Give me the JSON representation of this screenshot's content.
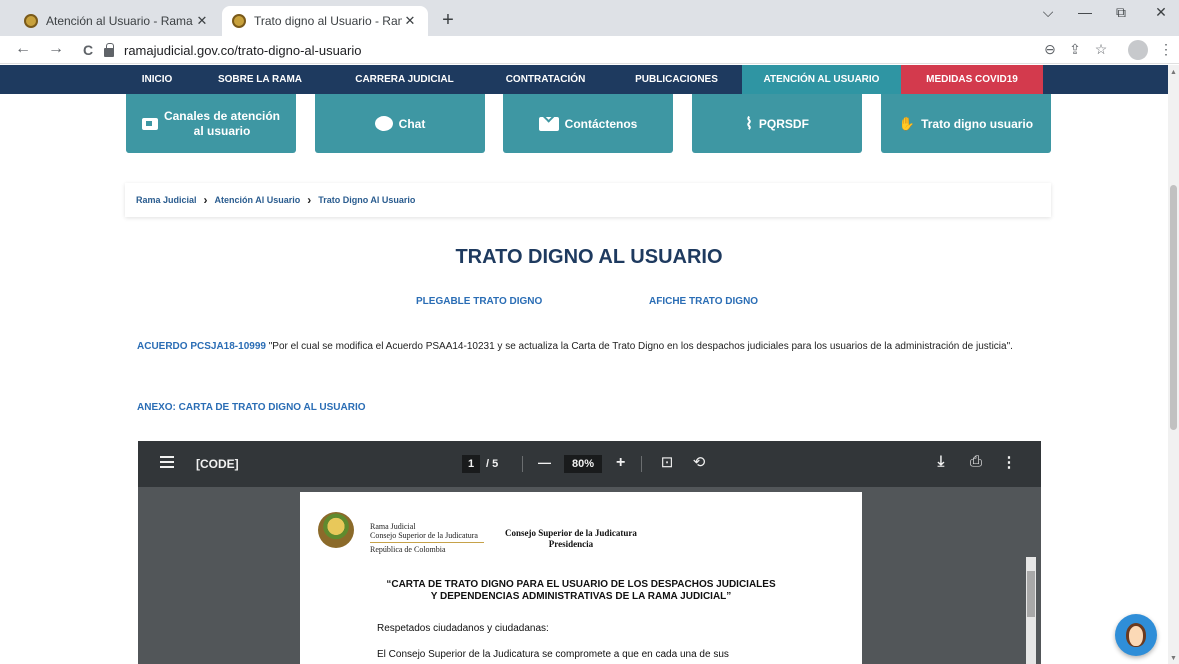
{
  "browser": {
    "tabs": [
      {
        "title": "Atención al Usuario - Rama Judicial",
        "close": "✕"
      },
      {
        "title": "Trato digno al Usuario - Rama Judicial",
        "close": "✕"
      }
    ],
    "new_tab": "+",
    "window_controls": [
      "⌵",
      "—",
      "⧉",
      "✕"
    ],
    "nav": {
      "back": "←",
      "forward": "→",
      "reload": "C"
    },
    "url": "ramajudicial.gov.co/trato-digno-al-usuario",
    "toolbar_icons": [
      "⊖",
      "⇪",
      "☆",
      "⋮"
    ]
  },
  "site_nav": {
    "items": [
      "INICIO",
      "SOBRE LA RAMA",
      "CARRERA JUDICIAL",
      "CONTRATACIÓN",
      "PUBLICACIONES",
      "ATENCIÓN AL USUARIO",
      "MEDIDAS COVID19"
    ],
    "active": "ATENCIÓN AL USUARIO"
  },
  "channels": [
    {
      "label_line1": "Canales de atención",
      "label_line2": "al usuario",
      "icon": "inbox-icon"
    },
    {
      "label": "Chat",
      "icon": "chat-bubble-icon"
    },
    {
      "label": "Contáctenos",
      "icon": "envelope-icon"
    },
    {
      "label": "PQRSDF",
      "icon": "paperclip-icon"
    },
    {
      "label": "Trato digno usuario",
      "icon": "handshake-icon"
    }
  ],
  "breadcrumb": [
    "Rama Judicial",
    "Atención Al Usuario",
    "Trato Digno Al Usuario"
  ],
  "breadcrumb_separator": "›",
  "page_title": "TRATO DIGNO AL USUARIO",
  "links": {
    "plegable": "PLEGABLE TRATO DIGNO",
    "afiche": "AFICHE TRATO DIGNO",
    "anexo": "ANEXO: CARTA DE TRATO DIGNO AL USUARIO"
  },
  "acuerdo": {
    "code": "ACUERDO PCSJA18-10999",
    "text": " \"Por el cual se modifica el Acuerdo PSAA14-10231 y se actualiza la Carta de Trato Digno en los despachos judiciales para los usuarios de la administración de justicia\"."
  },
  "pdf_viewer": {
    "filename": "[CODE]",
    "page_current": "1",
    "page_total": "/ 5",
    "zoom_minus": "—",
    "zoom": "80%",
    "zoom_plus": "+",
    "document": {
      "org_line1": "Rama Judicial",
      "org_line2": "Consejo Superior de la Judicatura",
      "org_line3": "República de Colombia",
      "head_line1": "Consejo Superior de la Judicatura",
      "head_line2": "Presidencia",
      "title_line1": "“CARTA DE TRATO DIGNO PARA EL USUARIO DE LOS DESPACHOS JUDICIALES",
      "title_line2": "Y DEPENDENCIAS ADMINISTRATIVAS DE LA RAMA JUDICIAL”",
      "greeting": "Respetados ciudadanos y ciudadanas:",
      "body": "El Consejo Superior de la Judicatura se compromete a que en cada una de sus"
    }
  }
}
